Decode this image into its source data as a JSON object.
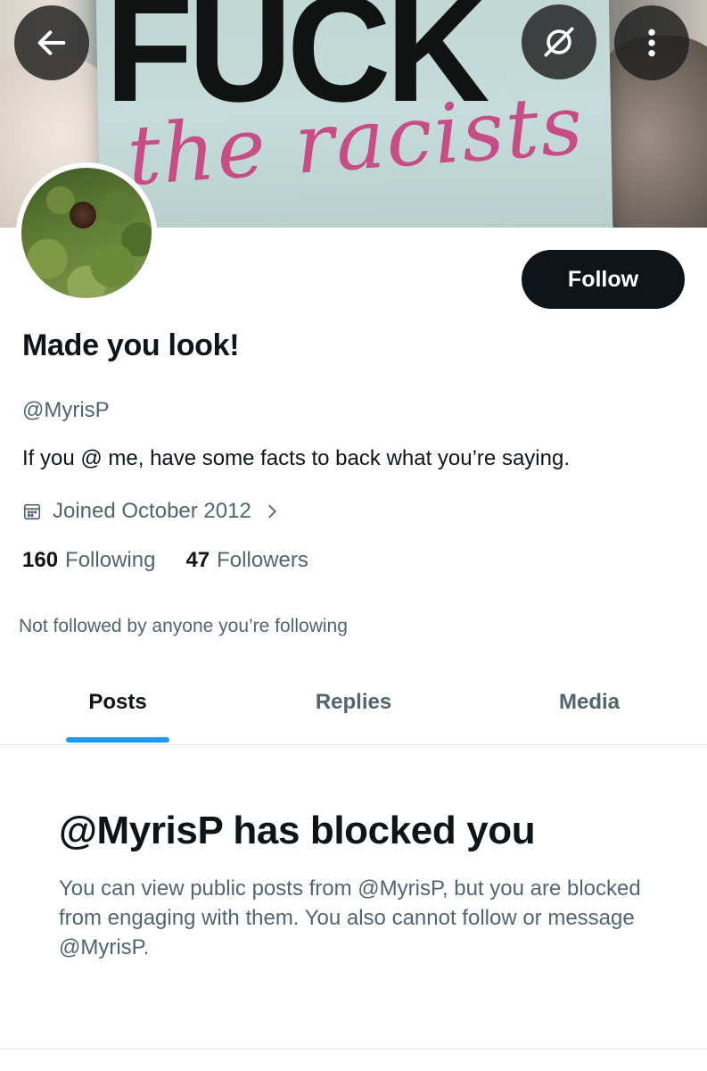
{
  "banner": {
    "big_text": "FUCK",
    "script_text": "the racists",
    "icons": {
      "back": "arrow-left-icon",
      "grok": "grok-icon",
      "more": "more-vertical-icon"
    }
  },
  "profile": {
    "display_name": "Made you look!",
    "handle": "@MyrisP",
    "bio": "If you @ me, have some facts to back what you’re saying.",
    "joined": "Joined October 2012",
    "following_count": "160",
    "following_label": "Following",
    "followers_count": "47",
    "followers_label": "Followers",
    "not_followed": "Not followed by anyone you’re following"
  },
  "follow_button": {
    "label": "Follow"
  },
  "tabs": [
    {
      "label": "Posts",
      "active": true
    },
    {
      "label": "Replies",
      "active": false
    },
    {
      "label": "Media",
      "active": false
    }
  ],
  "blocked": {
    "title": "@MyrisP has blocked you",
    "body": "You can view public posts from @MyrisP, but you are blocked from engaging with them. You also cannot follow or message @MyrisP."
  },
  "colors": {
    "accent": "#1d9bf0",
    "text_primary": "#0f1419",
    "text_secondary": "#536471",
    "follow_bg": "#0f1419"
  }
}
